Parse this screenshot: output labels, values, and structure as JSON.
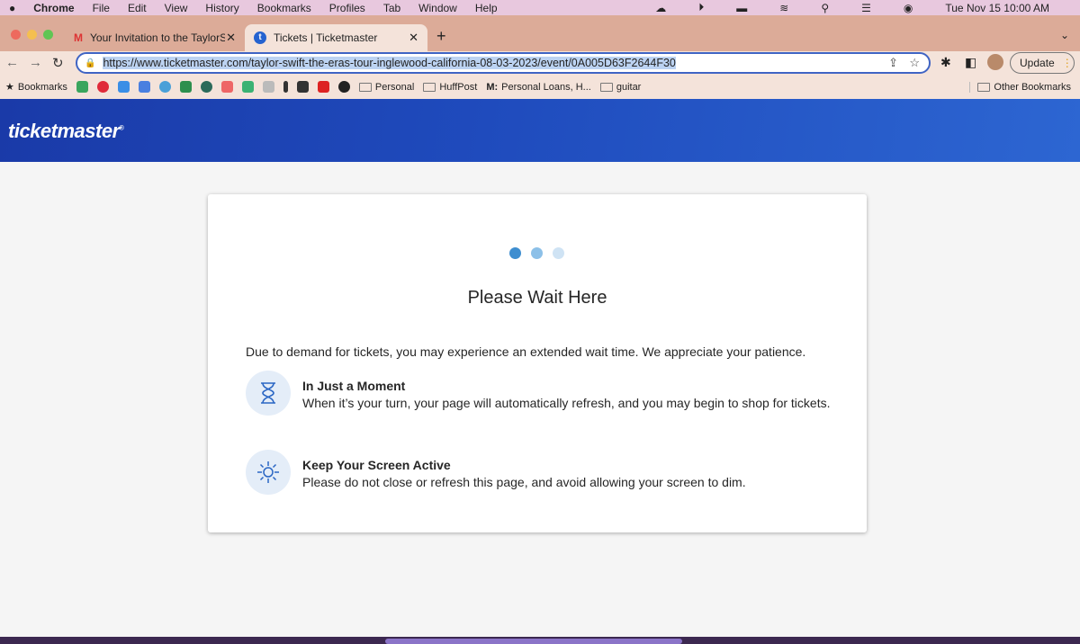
{
  "menubar": {
    "app": "Chrome",
    "items": [
      "File",
      "Edit",
      "View",
      "History",
      "Bookmarks",
      "Profiles",
      "Tab",
      "Window",
      "Help"
    ],
    "datetime": "Tue Nov 15  10:00 AM"
  },
  "tabs": [
    {
      "label": "Your Invitation to the TaylorSw",
      "icon": "gmail-icon"
    },
    {
      "label": "Tickets | Ticketmaster",
      "icon": "ticketmaster-icon",
      "active": true
    }
  ],
  "toolbar": {
    "url": "https://www.ticketmaster.com/taylor-swift-the-eras-tour-inglewood-california-08-03-2023/event/0A005D63F2644F30",
    "update_label": "Update"
  },
  "bookmarks": {
    "label": "Bookmarks",
    "folders": [
      "Personal",
      "HuffPost"
    ],
    "loans": "Personal Loans, H...",
    "loans_prefix": "M:",
    "guitar": "guitar",
    "other": "Other Bookmarks"
  },
  "site": {
    "logo": "ticketmaster",
    "brand_color": "#1f4bbd"
  },
  "wait": {
    "title": "Please Wait Here",
    "intro": "Due to demand for tickets, you may experience an extended wait time. We appreciate your patience.",
    "items": [
      {
        "title": "In Just a Moment",
        "text": "When it’s your turn, your page will automatically refresh, and you may begin to shop for tickets.",
        "icon": "hourglass-icon"
      },
      {
        "title": "Keep Your Screen Active",
        "text": "Please do not close or refresh this page, and avoid allowing your screen to dim.",
        "icon": "sun-icon"
      }
    ]
  }
}
